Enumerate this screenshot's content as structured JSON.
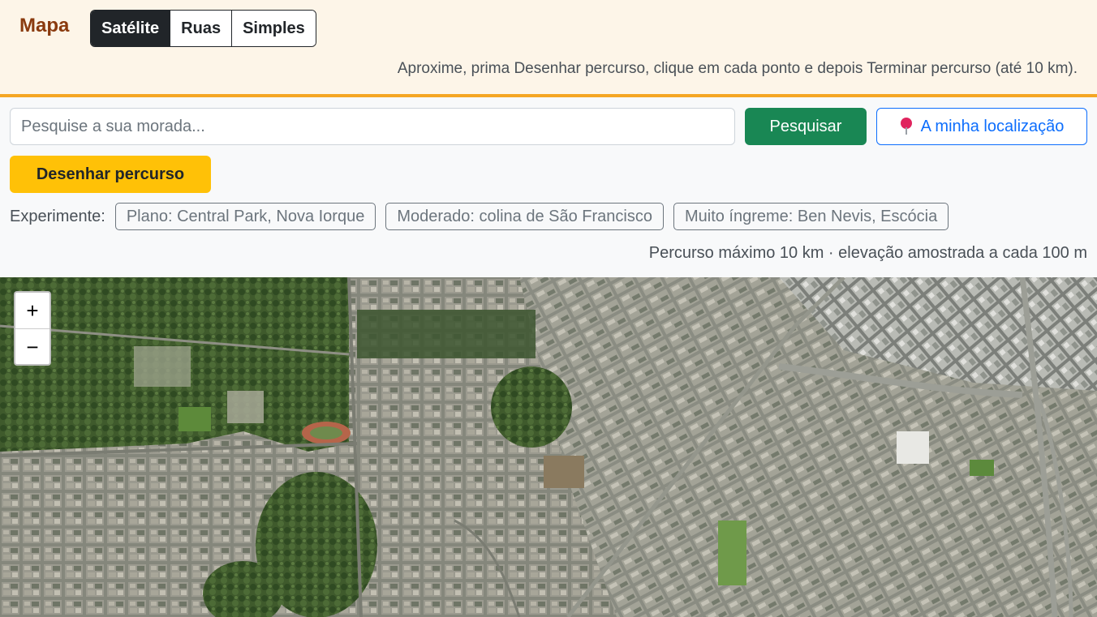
{
  "header": {
    "brand": "Mapa",
    "layers": [
      {
        "label": "Satélite",
        "active": true
      },
      {
        "label": "Ruas",
        "active": false
      },
      {
        "label": "Simples",
        "active": false
      }
    ],
    "hint": "Aproxime, prima Desenhar percurso, clique em cada ponto e depois Terminar percurso (até 10 km)."
  },
  "search": {
    "placeholder": "Pesquise a sua morada...",
    "value": "",
    "search_label": "Pesquisar",
    "location_label": "A minha localização",
    "location_icon": "pin-icon"
  },
  "draw": {
    "label": "Desenhar percurso"
  },
  "examples": {
    "label": "Experimente:",
    "items": [
      "Plano: Central Park, Nova Iorque",
      "Moderado: colina de São Francisco",
      "Muito íngreme: Ben Nevis, Escócia"
    ]
  },
  "limit_note": "Percurso máximo 10 km · elevação amostrada a cada 100 m",
  "map": {
    "zoom_in": "+",
    "zoom_out": "−"
  },
  "colors": {
    "brand": "#8a3a0e",
    "header_bg": "#fdf5e8",
    "header_border": "#f5a623",
    "search_button": "#198754",
    "location_button": "#0d6efd",
    "draw_button": "#ffc107"
  }
}
